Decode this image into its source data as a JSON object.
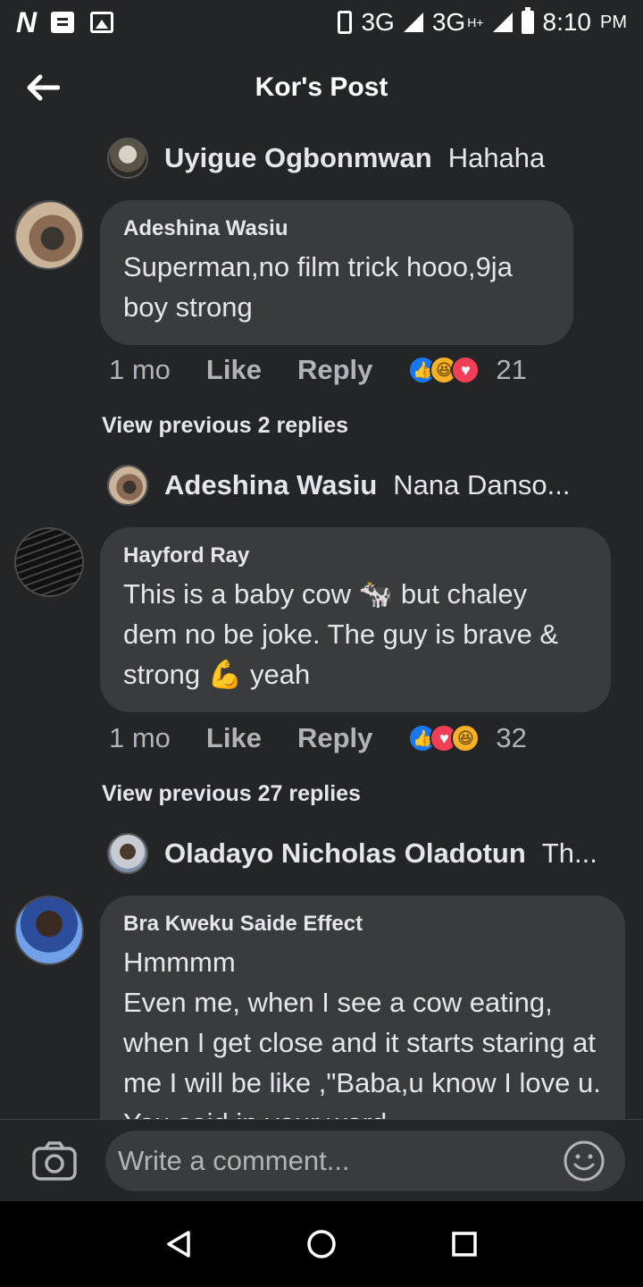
{
  "status_bar": {
    "network_1": "3G",
    "network_2": "3G",
    "network_2_super": "H+",
    "time": "8:10",
    "ampm": "PM",
    "icons": [
      "netflix-n-icon",
      "message-icon",
      "image-icon",
      "vibrate-icon",
      "signal-icon",
      "battery-icon"
    ]
  },
  "header": {
    "title": "Kor's Post",
    "back_icon": "arrow-left-icon"
  },
  "threads": [
    {
      "reply_preview": {
        "name": "Uyigue Ogbonmwan",
        "text": "Hahaha"
      },
      "comment": {
        "author": "Adeshina Wasiu",
        "body": "Superman,no film trick hooo,9ja boy strong",
        "time": "1 mo",
        "like": "Like",
        "reply": "Reply",
        "reactions": [
          "like",
          "haha",
          "love"
        ],
        "count": "21"
      }
    },
    {
      "view_previous": "View previous 2 replies",
      "reply_preview": {
        "name": "Adeshina Wasiu",
        "text": "Nana Danso..."
      },
      "comment": {
        "author": "Hayford Ray",
        "body": "This is a baby cow 🐄 but chaley dem no be joke. The guy is brave & strong 💪 yeah",
        "time": "1 mo",
        "like": "Like",
        "reply": "Reply",
        "reactions": [
          "like",
          "love",
          "haha"
        ],
        "count": "32"
      }
    },
    {
      "view_previous": "View previous 27 replies",
      "reply_preview": {
        "name": "Oladayo Nicholas Oladotun",
        "text": "Th..."
      },
      "comment": {
        "author": "Bra Kweku Saide Effect",
        "body": "Hmmmm\nEven me, when I see a cow eating, when I get close and it starts staring at me I will be like ,\"Baba,u know I love u. You said in your word"
      }
    }
  ],
  "composer": {
    "placeholder": "Write a comment...",
    "camera_icon": "camera-icon",
    "emoji_icon": "emoji-icon"
  },
  "navbar": {
    "icons": [
      "back-triangle-icon",
      "home-circle-icon",
      "recents-square-icon"
    ]
  },
  "colors": {
    "background": "#242526",
    "bubble": "#3a3b3c",
    "text": "#e4e6eb",
    "secondary_text": "#b0b3b8",
    "like_blue": "#1877f2",
    "love_red": "#f33e58",
    "haha_yellow": "#f7b125"
  }
}
